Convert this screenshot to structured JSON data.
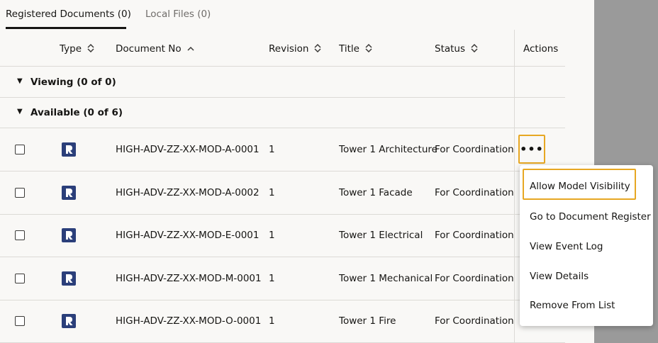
{
  "tabs": {
    "registered": "Registered Documents (0)",
    "local": "Local Files (0)"
  },
  "columns": {
    "type": "Type",
    "document_no": "Document No",
    "revision": "Revision",
    "title": "Title",
    "status": "Status",
    "actions": "Actions"
  },
  "groups": {
    "viewing": "Viewing (0 of 0)",
    "available": "Available (0 of 6)"
  },
  "rows": [
    {
      "document_no": "HIGH-ADV-ZZ-XX-MOD-A-0001",
      "revision": "1",
      "title": "Tower 1 Architecture",
      "status": "For Coordination"
    },
    {
      "document_no": "HIGH-ADV-ZZ-XX-MOD-A-0002",
      "revision": "1",
      "title": "Tower 1 Facade",
      "status": "For Coordination"
    },
    {
      "document_no": "HIGH-ADV-ZZ-XX-MOD-E-0001",
      "revision": "1",
      "title": "Tower 1 Electrical",
      "status": "For Coordination"
    },
    {
      "document_no": "HIGH-ADV-ZZ-XX-MOD-M-0001",
      "revision": "1",
      "title": "Tower 1 Mechanical",
      "status": "For Coordination"
    },
    {
      "document_no": "HIGH-ADV-ZZ-XX-MOD-O-0001",
      "revision": "1",
      "title": "Tower 1 Fire",
      "status": "For Coordination"
    }
  ],
  "actions_button": "•••",
  "menu": {
    "items": [
      "Allow Model Visibility",
      "Go to Document Register",
      "View Event Log",
      "View Details",
      "Remove From List"
    ]
  },
  "icons": {
    "sort_unsorted": "⌃⌄",
    "sort_asc": "⌃",
    "expand_caret": "▼",
    "type_icon": "revit-model-icon"
  },
  "colors": {
    "highlight": "#e7a723",
    "type_icon_bg": "#2b3f7a"
  }
}
